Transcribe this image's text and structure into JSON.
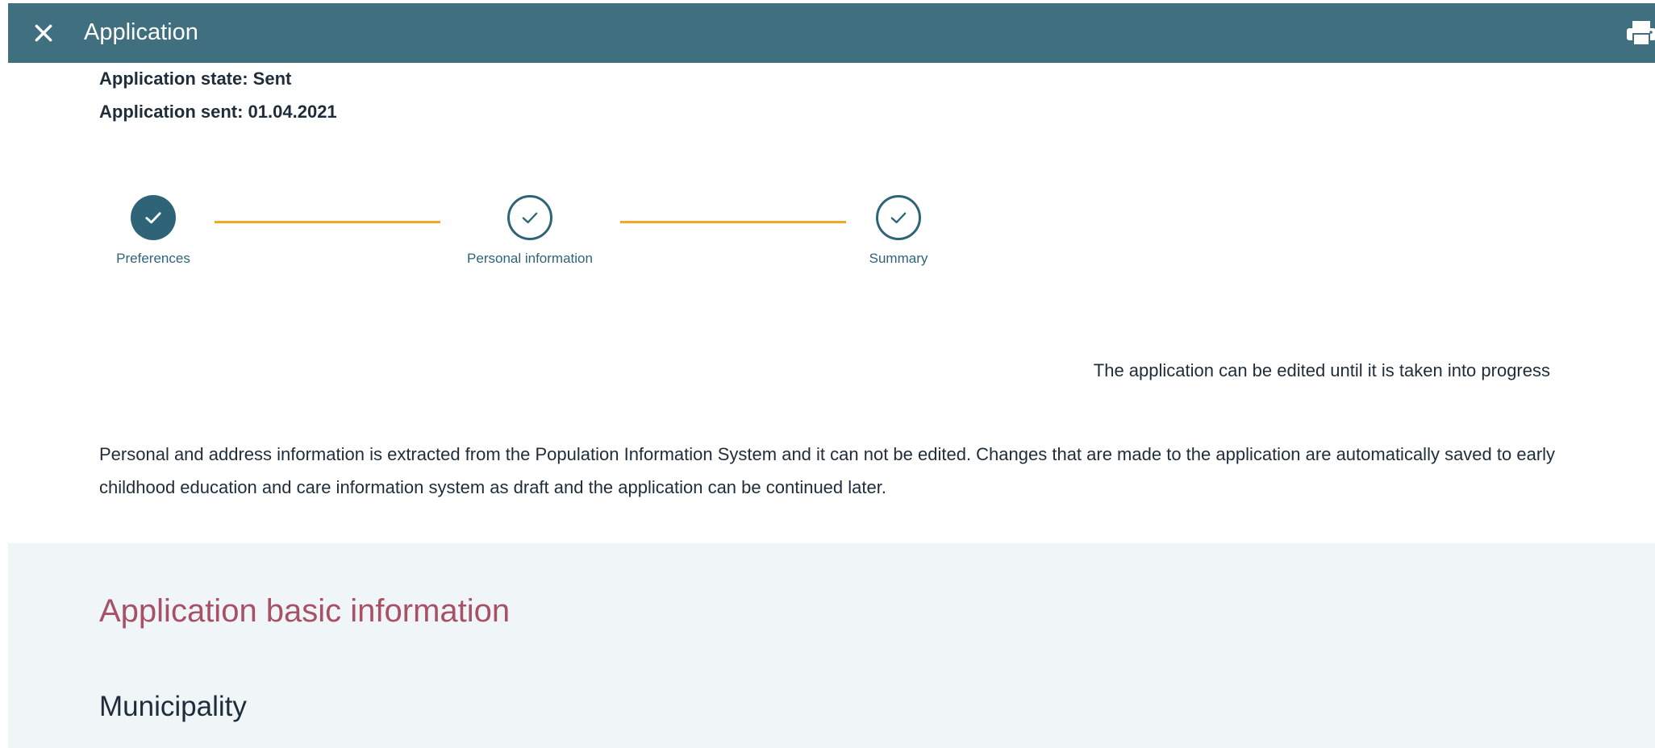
{
  "topbar": {
    "title": "Application",
    "close_icon": "close-icon",
    "print_icon": "printer-icon",
    "background": "#406f7f"
  },
  "application": {
    "state_line": "Application state: Sent",
    "sent_line": "Application sent: 01.04.2021"
  },
  "stepper": {
    "steps": [
      {
        "label": "Preferences",
        "status": "current-complete"
      },
      {
        "label": "Personal information",
        "status": "complete"
      },
      {
        "label": "Summary",
        "status": "complete"
      }
    ],
    "accent_color": "#2f6478",
    "line_color": "#f5a623"
  },
  "edit_note": "The application can be edited until it is taken into progress",
  "info_text": "Personal and address information is extracted from the Population Information System and it can not be edited. Changes that are made to the application are automatically saved to early childhood education and care information system as draft and the application can be continued later.",
  "section": {
    "title": "Application basic information",
    "subheading": "Municipality",
    "title_color": "#a85066",
    "background": "#f0f5f7"
  }
}
